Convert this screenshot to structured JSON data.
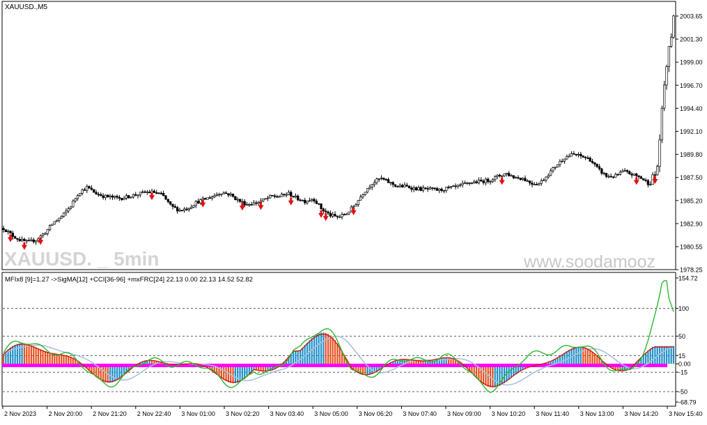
{
  "window": {
    "symbol_label": "XAUUSD.,M5"
  },
  "watermark": {
    "left": "XAUUSD. _ 5min",
    "right": "www.soodamooz"
  },
  "price_axis": {
    "labels": [
      "2003.65",
      "2001.30",
      "1999.00",
      "1996.70",
      "1994.40",
      "1992.10",
      "1989.80",
      "1987.50",
      "1985.20",
      "1982.90",
      "1980.55",
      "1978.25"
    ]
  },
  "indicator": {
    "header": "MFIx8 [9]=1.27 ->SigMA[12] +CCI[36-96] +mxFRC[24] 22.13 0.00 22.13 14.52 52.82",
    "axis_labels": [
      "154.72",
      "100",
      "50",
      "15",
      "0.00",
      "-15",
      "-50",
      "-68.79"
    ]
  },
  "time_axis": {
    "labels": [
      "2 Nov 2023",
      "2 Nov 20:00",
      "2 Nov 21:20",
      "2 Nov 22:40",
      "3 Nov 01:00",
      "3 Nov 02:20",
      "3 Nov 03:40",
      "3 Nov 05:00",
      "3 Nov 06:20",
      "3 Nov 07:40",
      "3 Nov 09:00",
      "3 Nov 10:20",
      "3 Nov 11:40",
      "3 Nov 13:00",
      "3 Nov 14:20",
      "3 Nov 15:40"
    ]
  },
  "colors": {
    "bull_bar": "#1e90c8",
    "bear_bar": "#e8501e",
    "cci_line": "#2db82d",
    "signal_line": "#a8c0e0",
    "mfi_line": "#d01818",
    "zero_band": "#ff00ff",
    "arrow": "#e01010"
  },
  "chart_data": {
    "type": "candlestick",
    "price_close_path": [
      1982.4,
      1981.7,
      1981.2,
      1981.0,
      1981.3,
      1982.0,
      1983.0,
      1983.6,
      1984.6,
      1986.0,
      1986.5,
      1985.9,
      1985.6,
      1985.5,
      1985.4,
      1985.6,
      1985.8,
      1986.0,
      1986.0,
      1985.7,
      1984.6,
      1984.2,
      1984.4,
      1985.0,
      1985.3,
      1985.6,
      1986.0,
      1985.8,
      1985.2,
      1984.8,
      1984.9,
      1985.2,
      1985.6,
      1985.6,
      1985.9,
      1985.4,
      1985.1,
      1985.4,
      1984.3,
      1983.7,
      1983.5,
      1983.9,
      1984.8,
      1986.0,
      1986.9,
      1987.4,
      1987.0,
      1986.6,
      1986.6,
      1986.4,
      1986.3,
      1986.3,
      1986.2,
      1986.4,
      1986.5,
      1986.8,
      1987.0,
      1987.1,
      1987.2,
      1987.6,
      1987.9,
      1987.5,
      1987.4,
      1986.9,
      1986.9,
      1987.8,
      1988.7,
      1989.5,
      1989.8,
      1989.6,
      1989.3,
      1988.3,
      1987.6,
      1987.6,
      1988.1,
      1987.8,
      1987.5,
      1986.9,
      1988.0,
      1997.8,
      2003.3
    ]
  }
}
